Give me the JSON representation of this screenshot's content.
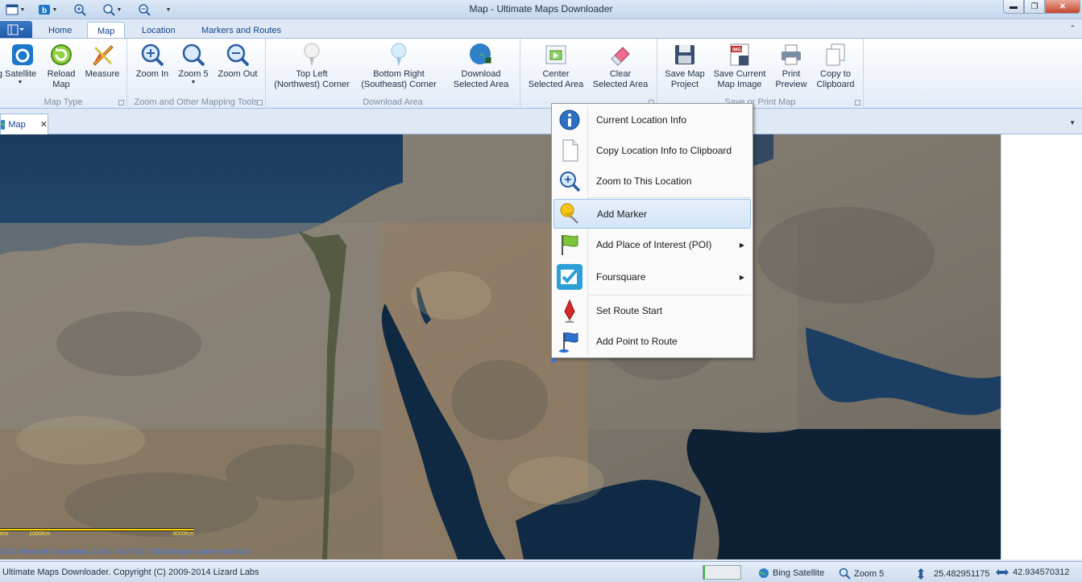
{
  "window": {
    "title": "Map - Ultimate Maps Downloader"
  },
  "ribbon_tabs": [
    {
      "label": "Home"
    },
    {
      "label": "Map"
    },
    {
      "label": "Location"
    },
    {
      "label": "Markers and Routes"
    }
  ],
  "ribbon": {
    "map_type": {
      "label": "Map Type",
      "buttons": [
        "g Satellite",
        "Reload\nMap",
        "Measure"
      ]
    },
    "zoom": {
      "label": "Zoom and Other Mapping Tools",
      "buttons": [
        "Zoom In",
        "Zoom 5",
        "Zoom Out"
      ]
    },
    "download": {
      "label": "Download Area",
      "buttons": [
        "Top Left\n(Northwest) Corner",
        "Bottom Right\n(Southeast) Corner",
        "Download\nSelected Area"
      ]
    },
    "center": {
      "buttons": [
        "Center\nSelected Area",
        "Clear\nSelected Area"
      ]
    },
    "save": {
      "label": "Save or Print Map",
      "buttons": [
        "Save Map\nProject",
        "Save Current\nMap Image",
        "Print\nPreview",
        "Copy to\nClipboard"
      ]
    }
  },
  "doc_tab": {
    "label": "Map"
  },
  "map": {
    "scale_labels": [
      "Km",
      "1000Km",
      "3000Km"
    ],
    "copyright": "2014 Microsoft Corporation, ©2014 NAVTEQ, ©2014 Image courtesy of NASA"
  },
  "context_menu": {
    "items": [
      {
        "label": "Current Location Info",
        "icon": "info-icon"
      },
      {
        "label": "Copy Location Info to Clipboard",
        "icon": "copy-icon"
      },
      {
        "label": "Zoom to This Location",
        "icon": "zoom-icon"
      },
      {
        "label": "Add Marker",
        "icon": "pushpin-icon",
        "highlighted": true
      },
      {
        "label": "Add Place of Interest (POI)",
        "icon": "flag-icon",
        "submenu": true
      },
      {
        "label": "Foursquare",
        "icon": "foursquare-check-icon",
        "submenu": true
      },
      {
        "label": "Set Route Start",
        "icon": "route-start-icon"
      },
      {
        "label": "Add Point to Route",
        "icon": "route-point-flag-icon"
      }
    ]
  },
  "status": {
    "copyright": "Ultimate Maps Downloader. Copyright (C) 2009-2014 Lizard Labs",
    "progress": 0.05,
    "map_type": "Bing Satellite",
    "zoom": "Zoom 5",
    "latitude": "25.482951175",
    "longitude": "42.934570312"
  },
  "colors": {
    "ribbon_text": "#1e395b",
    "accent": "#1f58a8",
    "scale_bar": "#ffd400"
  }
}
